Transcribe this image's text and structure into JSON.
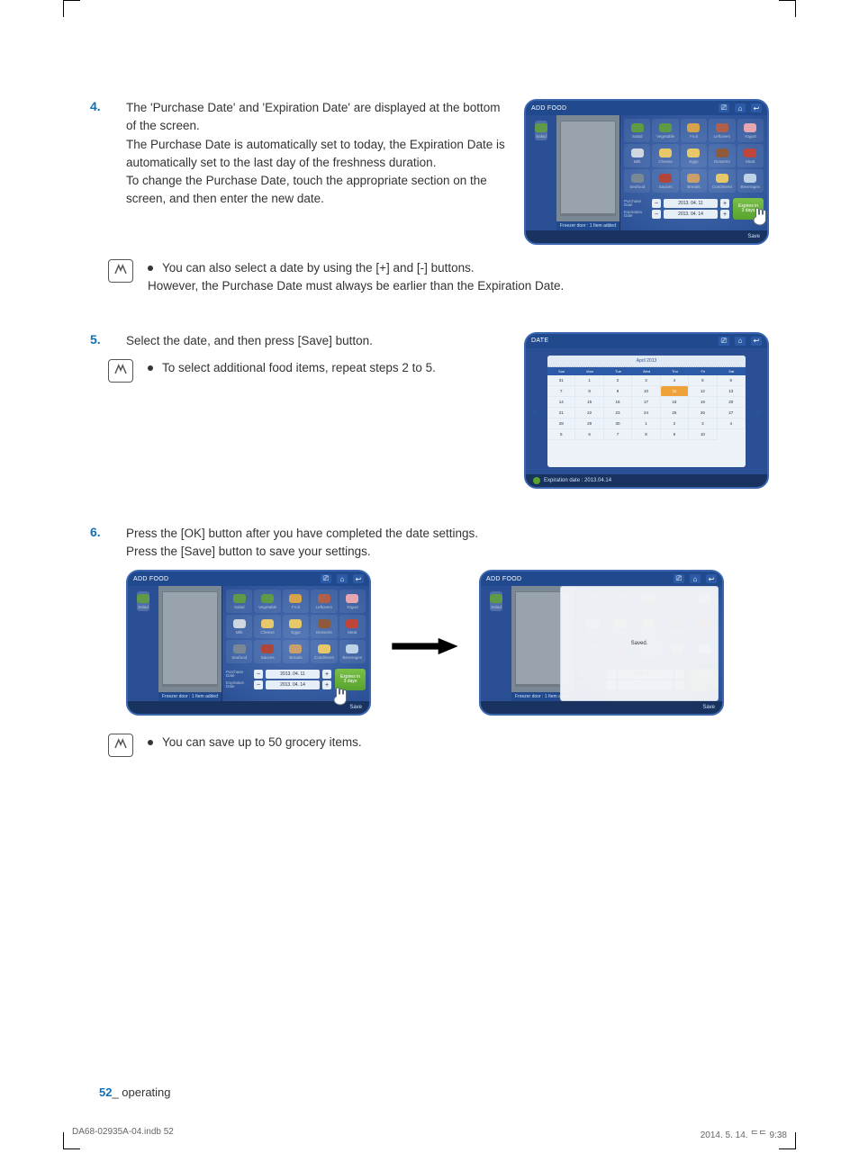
{
  "steps": {
    "s4": {
      "num": "4.",
      "text": "The 'Purchase Date' and 'Expiration Date' are displayed at the bottom of the screen.\nThe Purchase Date is automatically set to today, the Expiration Date is automatically set to the last day of the freshness duration.\nTo change the Purchase Date, touch the appropriate section on the screen, and then enter the new date."
    },
    "s5": {
      "num": "5.",
      "text": "Select the date, and then press [Save] button."
    },
    "s6": {
      "num": "6.",
      "text": "Press the [OK] button after you have completed the date settings.\nPress the [Save] button to save your settings."
    }
  },
  "notes": {
    "n1": "You can also select a date by using the [+] and [-] buttons.\nHowever, the Purchase Date must always be earlier than the Expiration Date.",
    "n2": "To select additional food items, repeat steps 2 to 5.",
    "n3": "You can save up to 50 grocery items."
  },
  "shot": {
    "addfood_title": "ADD FOOD",
    "date_title": "DATE",
    "fridge_status": "Freezer door : 1 Item added",
    "side_item": "Salad",
    "foods": [
      "Salad",
      "Vegetable",
      "Fruit",
      "Leftovers",
      "Yogurt",
      "Milk",
      "Cheese",
      "Eggs",
      "Desserts",
      "Meat",
      "Seafood",
      "Sauces",
      "Breads",
      "Condiment",
      "Beverages"
    ],
    "food_colors": [
      "#5f9a46",
      "#5f9a46",
      "#d6a34a",
      "#b0604a",
      "#e6a6b0",
      "#cfd7e0",
      "#e6c76a",
      "#e6c76a",
      "#8f5a3c",
      "#c0453a",
      "#7a8896",
      "#b0453a",
      "#caa06a",
      "#e6c76a",
      "#bcd4e6"
    ],
    "purchase_lbl": "Purchase\nDate",
    "expiration_lbl": "Expiration\nDate",
    "purchase_val": "2013. 04. 11",
    "expiration_val": "2013. 04. 14",
    "expires_in": "Expires in\n3 days",
    "save": "Save",
    "saved": "Saved.",
    "cal_month": "April 2013",
    "cal_days": [
      "Sun",
      "Mon",
      "Tue",
      "Wed",
      "Thu",
      "Fri",
      "Sat"
    ],
    "cal_cells": [
      "31",
      "1",
      "2",
      "3",
      "4",
      "5",
      "6",
      "7",
      "8",
      "9",
      "10",
      "11",
      "12",
      "13",
      "14",
      "15",
      "16",
      "17",
      "18",
      "19",
      "20",
      "21",
      "22",
      "23",
      "24",
      "25",
      "26",
      "27",
      "28",
      "29",
      "30",
      "1",
      "2",
      "3",
      "4",
      "5",
      "6",
      "7",
      "8",
      "9",
      "10"
    ],
    "cal_selected_index": 11,
    "cal_status": "Expiration date : 2013.04.14"
  },
  "footer": {
    "pagenum": "52",
    "section": "_ operating"
  },
  "printfoot": {
    "left": "DA68-02935A-04.indb   52",
    "right": "2014. 5. 14.   ᄃᄃ 9:38"
  }
}
